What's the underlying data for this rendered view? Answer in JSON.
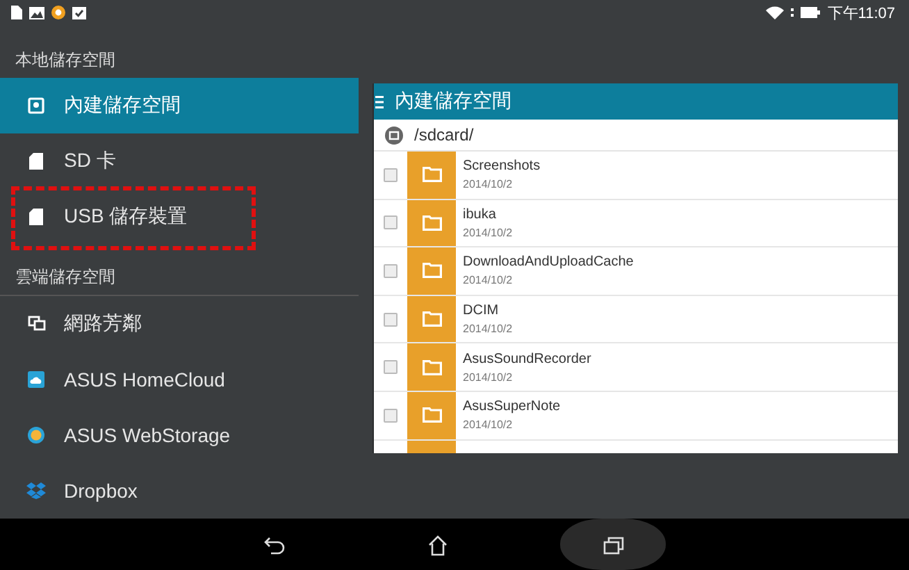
{
  "status_bar": {
    "time": "下午11:07"
  },
  "drawer": {
    "sections": [
      {
        "title": "本地儲存空間",
        "items": [
          {
            "label": "內建儲存空間",
            "kind": "internal",
            "selected": true,
            "highlighted": false
          },
          {
            "label": "SD 卡",
            "kind": "sd",
            "selected": false,
            "highlighted": false
          },
          {
            "label": "USB 儲存裝置",
            "kind": "usb",
            "selected": false,
            "highlighted": true
          }
        ]
      },
      {
        "title": "雲端儲存空間",
        "items": [
          {
            "label": "網路芳鄰",
            "kind": "network",
            "selected": false,
            "highlighted": false
          },
          {
            "label": "ASUS HomeCloud",
            "kind": "homecloud",
            "selected": false,
            "highlighted": false
          },
          {
            "label": "ASUS WebStorage",
            "kind": "webstorage",
            "selected": false,
            "highlighted": false
          },
          {
            "label": "Dropbox",
            "kind": "dropbox",
            "selected": false,
            "highlighted": false
          }
        ]
      }
    ]
  },
  "panel": {
    "title": "內建儲存空間",
    "path": "/sdcard/",
    "files": [
      {
        "name": "Screenshots",
        "date": "2014/10/2",
        "checked": false
      },
      {
        "name": "ibuka",
        "date": "2014/10/2",
        "checked": false
      },
      {
        "name": "DownloadAndUploadCache",
        "date": "2014/10/2",
        "checked": false
      },
      {
        "name": "DCIM",
        "date": "2014/10/2",
        "checked": false
      },
      {
        "name": "AsusSoundRecorder",
        "date": "2014/10/2",
        "checked": false
      },
      {
        "name": "AsusSuperNote",
        "date": "2014/10/2",
        "checked": false
      }
    ]
  },
  "nav_bar": {
    "buttons": [
      {
        "kind": "back",
        "pressed": false
      },
      {
        "kind": "home",
        "pressed": false
      },
      {
        "kind": "recent",
        "pressed": true
      }
    ]
  }
}
